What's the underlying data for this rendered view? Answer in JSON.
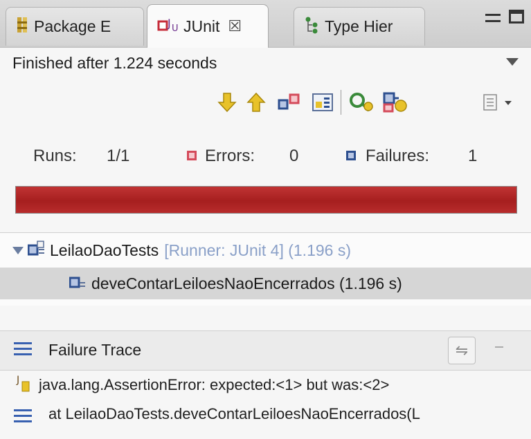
{
  "tabs": [
    {
      "label": "Package E",
      "icon": "package-explorer-icon",
      "active": false
    },
    {
      "label": "JUnit",
      "icon": "junit-icon",
      "close": "☒",
      "active": true
    },
    {
      "label": "Type Hier",
      "icon": "type-hierarchy-icon",
      "active": false
    }
  ],
  "status": "Finished after 1.224 seconds",
  "toolbar": {
    "items": [
      "next-failure-icon",
      "previous-failure-icon",
      "show-failures-only-icon",
      "scroll-lock-icon",
      "rerun-test-icon",
      "rerun-failed-first-icon",
      "history-dropdown-icon"
    ]
  },
  "counters": {
    "runs_label": "Runs:",
    "runs_value": "1/1",
    "errors_label": "Errors:",
    "errors_value": "0",
    "failures_label": "Failures:",
    "failures_value": "1"
  },
  "progress": {
    "fraction": 1.0,
    "color": "#b32424"
  },
  "tree": {
    "suite_name": "LeilaoDaoTests",
    "suite_meta": "[Runner: JUnit 4] (1.196 s)",
    "test_name": "deveContarLeiloesNaoEncerrados (1.196 s)"
  },
  "failure_trace": {
    "title": "Failure Trace",
    "lines": [
      "java.lang.AssertionError: expected:<1> but was:<2>",
      "at LeilaoDaoTests.deveContarLeiloesNaoEncerrados(L"
    ]
  },
  "colors": {
    "error": "#d44a5a",
    "failure": "#2d4f8f",
    "accent": "#3860b0"
  }
}
